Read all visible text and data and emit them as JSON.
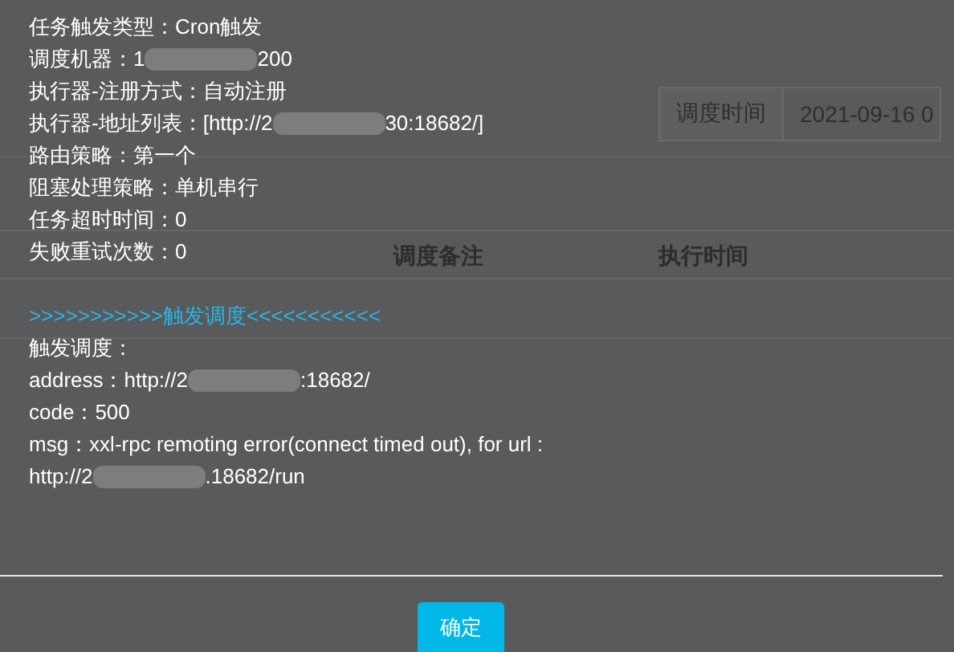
{
  "background_page": {
    "filter": {
      "label": "调度时间",
      "date_value": "2021-09-16 0"
    },
    "table": {
      "columns": [
        "调度备注",
        "执行时间"
      ]
    }
  },
  "dialog": {
    "fields": [
      {
        "label": "任务触发类型：",
        "value": "Cron触发",
        "redacted": false
      },
      {
        "label": "调度机器：",
        "value": "1",
        "value_after": "200",
        "redacted": true
      },
      {
        "label": "执行器-注册方式：",
        "value": "自动注册",
        "redacted": false
      },
      {
        "label": "执行器-地址列表：",
        "value": "[http://2",
        "value_after": "30:18682/]",
        "redacted": true
      },
      {
        "label": "路由策略：",
        "value": "第一个",
        "redacted": false
      },
      {
        "label": "阻塞处理策略：",
        "value": "单机串行",
        "redacted": false
      },
      {
        "label": "任务超时时间：",
        "value": "0",
        "redacted": false
      },
      {
        "label": "失败重试次数：",
        "value": "0",
        "redacted": false
      }
    ],
    "section_heading": ">>>>>>>>>>>触发调度<<<<<<<<<<<",
    "log_lines": [
      {
        "text": "触发调度：",
        "redacted": false
      },
      {
        "text": "address：http://2",
        "text_after": ":18682/",
        "redacted": true
      },
      {
        "text": "code：500",
        "redacted": false
      },
      {
        "text": "msg：xxl-rpc remoting error(connect timed out), for url :",
        "redacted": false
      },
      {
        "text": "http://2",
        "text_after": ".18682/run",
        "redacted": true
      }
    ],
    "confirm_button": "确定"
  }
}
